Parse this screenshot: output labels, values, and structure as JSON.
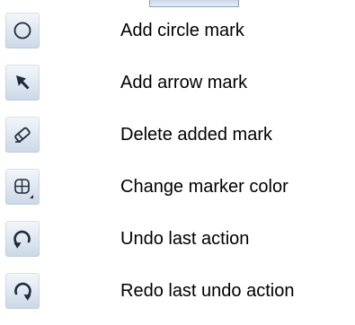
{
  "legend": {
    "items": [
      {
        "icon": "circle-mark-icon",
        "label": "Add circle mark"
      },
      {
        "icon": "arrow-mark-icon",
        "label": "Add arrow mark"
      },
      {
        "icon": "eraser-icon",
        "label": "Delete added mark"
      },
      {
        "icon": "marker-color-icon",
        "label": "Change marker color"
      },
      {
        "icon": "undo-icon",
        "label": "Undo last action"
      },
      {
        "icon": "redo-icon",
        "label": "Redo last undo action"
      }
    ]
  },
  "colors": {
    "icon_stroke": "#1f2a3a",
    "button_light": "#f4f7fb",
    "button_dark": "#ccd8e6",
    "text": "#000000"
  }
}
